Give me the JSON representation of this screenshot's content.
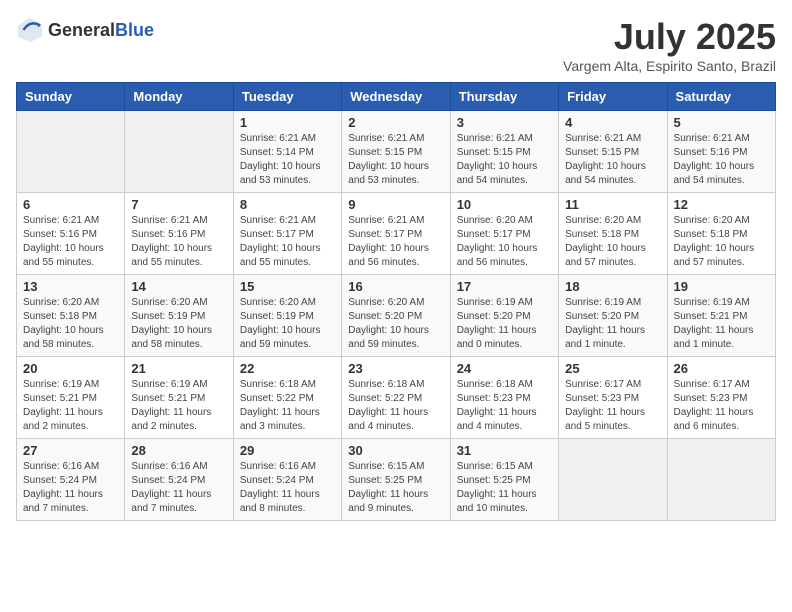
{
  "header": {
    "logo_general": "General",
    "logo_blue": "Blue",
    "month_year": "July 2025",
    "location": "Vargem Alta, Espirito Santo, Brazil"
  },
  "weekdays": [
    "Sunday",
    "Monday",
    "Tuesday",
    "Wednesday",
    "Thursday",
    "Friday",
    "Saturday"
  ],
  "weeks": [
    [
      {
        "day": "",
        "info": ""
      },
      {
        "day": "",
        "info": ""
      },
      {
        "day": "1",
        "info": "Sunrise: 6:21 AM\nSunset: 5:14 PM\nDaylight: 10 hours and 53 minutes."
      },
      {
        "day": "2",
        "info": "Sunrise: 6:21 AM\nSunset: 5:15 PM\nDaylight: 10 hours and 53 minutes."
      },
      {
        "day": "3",
        "info": "Sunrise: 6:21 AM\nSunset: 5:15 PM\nDaylight: 10 hours and 54 minutes."
      },
      {
        "day": "4",
        "info": "Sunrise: 6:21 AM\nSunset: 5:15 PM\nDaylight: 10 hours and 54 minutes."
      },
      {
        "day": "5",
        "info": "Sunrise: 6:21 AM\nSunset: 5:16 PM\nDaylight: 10 hours and 54 minutes."
      }
    ],
    [
      {
        "day": "6",
        "info": "Sunrise: 6:21 AM\nSunset: 5:16 PM\nDaylight: 10 hours and 55 minutes."
      },
      {
        "day": "7",
        "info": "Sunrise: 6:21 AM\nSunset: 5:16 PM\nDaylight: 10 hours and 55 minutes."
      },
      {
        "day": "8",
        "info": "Sunrise: 6:21 AM\nSunset: 5:17 PM\nDaylight: 10 hours and 55 minutes."
      },
      {
        "day": "9",
        "info": "Sunrise: 6:21 AM\nSunset: 5:17 PM\nDaylight: 10 hours and 56 minutes."
      },
      {
        "day": "10",
        "info": "Sunrise: 6:20 AM\nSunset: 5:17 PM\nDaylight: 10 hours and 56 minutes."
      },
      {
        "day": "11",
        "info": "Sunrise: 6:20 AM\nSunset: 5:18 PM\nDaylight: 10 hours and 57 minutes."
      },
      {
        "day": "12",
        "info": "Sunrise: 6:20 AM\nSunset: 5:18 PM\nDaylight: 10 hours and 57 minutes."
      }
    ],
    [
      {
        "day": "13",
        "info": "Sunrise: 6:20 AM\nSunset: 5:18 PM\nDaylight: 10 hours and 58 minutes."
      },
      {
        "day": "14",
        "info": "Sunrise: 6:20 AM\nSunset: 5:19 PM\nDaylight: 10 hours and 58 minutes."
      },
      {
        "day": "15",
        "info": "Sunrise: 6:20 AM\nSunset: 5:19 PM\nDaylight: 10 hours and 59 minutes."
      },
      {
        "day": "16",
        "info": "Sunrise: 6:20 AM\nSunset: 5:20 PM\nDaylight: 10 hours and 59 minutes."
      },
      {
        "day": "17",
        "info": "Sunrise: 6:19 AM\nSunset: 5:20 PM\nDaylight: 11 hours and 0 minutes."
      },
      {
        "day": "18",
        "info": "Sunrise: 6:19 AM\nSunset: 5:20 PM\nDaylight: 11 hours and 1 minute."
      },
      {
        "day": "19",
        "info": "Sunrise: 6:19 AM\nSunset: 5:21 PM\nDaylight: 11 hours and 1 minute."
      }
    ],
    [
      {
        "day": "20",
        "info": "Sunrise: 6:19 AM\nSunset: 5:21 PM\nDaylight: 11 hours and 2 minutes."
      },
      {
        "day": "21",
        "info": "Sunrise: 6:19 AM\nSunset: 5:21 PM\nDaylight: 11 hours and 2 minutes."
      },
      {
        "day": "22",
        "info": "Sunrise: 6:18 AM\nSunset: 5:22 PM\nDaylight: 11 hours and 3 minutes."
      },
      {
        "day": "23",
        "info": "Sunrise: 6:18 AM\nSunset: 5:22 PM\nDaylight: 11 hours and 4 minutes."
      },
      {
        "day": "24",
        "info": "Sunrise: 6:18 AM\nSunset: 5:23 PM\nDaylight: 11 hours and 4 minutes."
      },
      {
        "day": "25",
        "info": "Sunrise: 6:17 AM\nSunset: 5:23 PM\nDaylight: 11 hours and 5 minutes."
      },
      {
        "day": "26",
        "info": "Sunrise: 6:17 AM\nSunset: 5:23 PM\nDaylight: 11 hours and 6 minutes."
      }
    ],
    [
      {
        "day": "27",
        "info": "Sunrise: 6:16 AM\nSunset: 5:24 PM\nDaylight: 11 hours and 7 minutes."
      },
      {
        "day": "28",
        "info": "Sunrise: 6:16 AM\nSunset: 5:24 PM\nDaylight: 11 hours and 7 minutes."
      },
      {
        "day": "29",
        "info": "Sunrise: 6:16 AM\nSunset: 5:24 PM\nDaylight: 11 hours and 8 minutes."
      },
      {
        "day": "30",
        "info": "Sunrise: 6:15 AM\nSunset: 5:25 PM\nDaylight: 11 hours and 9 minutes."
      },
      {
        "day": "31",
        "info": "Sunrise: 6:15 AM\nSunset: 5:25 PM\nDaylight: 11 hours and 10 minutes."
      },
      {
        "day": "",
        "info": ""
      },
      {
        "day": "",
        "info": ""
      }
    ]
  ]
}
